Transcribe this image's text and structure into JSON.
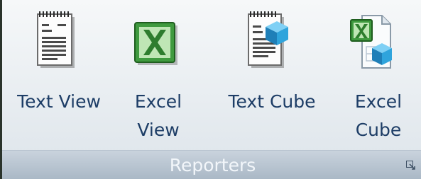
{
  "group": {
    "title": "Reporters"
  },
  "buttons": [
    {
      "id": "text-view",
      "label": "Text View",
      "icon": "text-document-icon"
    },
    {
      "id": "excel-view",
      "label": "Excel\nView",
      "icon": "excel-icon"
    },
    {
      "id": "text-cube",
      "label": "Text Cube",
      "icon": "text-cube-icon"
    },
    {
      "id": "excel-cube",
      "label": "Excel\nCube",
      "icon": "excel-cube-icon"
    }
  ],
  "colors": {
    "label": "#1d3d66",
    "group_title": "#f2f6fa",
    "excel_green": "#2f8a2f",
    "cube_blue": "#2f9ed8"
  },
  "launcher_icon": "dialog-launcher-icon"
}
